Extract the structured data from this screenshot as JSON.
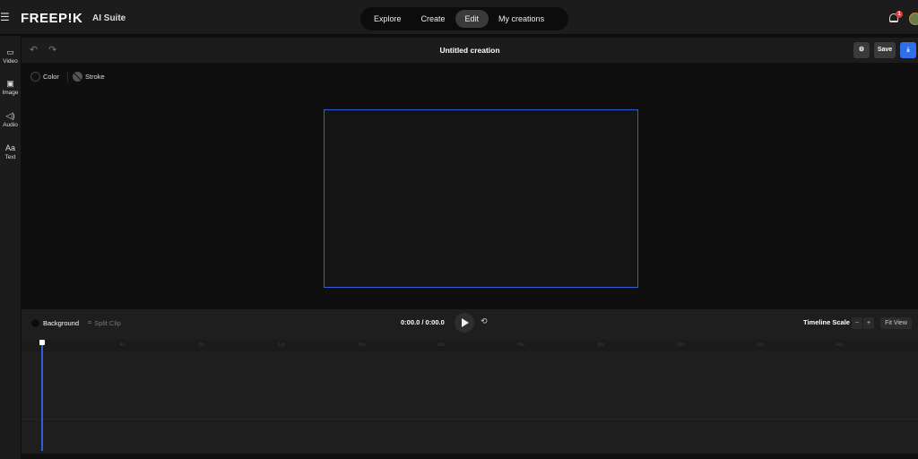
{
  "header": {
    "logo": "FREEP!K",
    "suite": "AI Suite",
    "nav": [
      "Explore",
      "Create",
      "Edit",
      "My creations"
    ],
    "active_nav": "Edit",
    "notification_count": "1"
  },
  "sidebar": {
    "items": [
      {
        "label": "Video",
        "icon": "video-icon"
      },
      {
        "label": "Image",
        "icon": "image-icon"
      },
      {
        "label": "Audio",
        "icon": "audio-icon"
      },
      {
        "label": "Text",
        "icon": "text-icon"
      }
    ]
  },
  "toolbar": {
    "title": "Untitled creation",
    "save_label": "Save"
  },
  "props": {
    "color_label": "Color",
    "stroke_label": "Stroke"
  },
  "timeline": {
    "background_label": "Background",
    "split_label": "Split Clip",
    "time": "0:00.0 / 0:00.0",
    "scale_label": "Timeline Scale",
    "minus": "−",
    "plus": "+",
    "fit_label": "Fit View",
    "ticks": [
      "4s",
      "8s",
      "12s",
      "16s",
      "20s",
      "24s",
      "28s",
      "32s",
      "36s",
      "40s"
    ],
    "tick_seconds": [
      4,
      8,
      12,
      16,
      20,
      24,
      28,
      32,
      36,
      40
    ]
  },
  "colors": {
    "accent": "#2f5fd8",
    "badge": "#e53935"
  }
}
